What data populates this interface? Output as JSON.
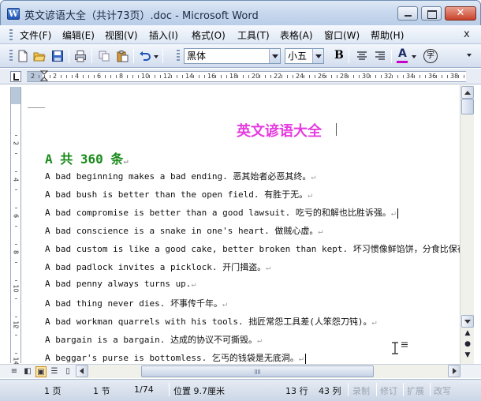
{
  "window": {
    "title": "英文谚语大全（共计73页）.doc - Microsoft Word",
    "app_icon_letter": "W",
    "close_glyph": "✕"
  },
  "menu": {
    "items": [
      "文件(F)",
      "编辑(E)",
      "视图(V)",
      "插入(I)",
      "格式(O)",
      "工具(T)",
      "表格(A)",
      "窗口(W)",
      "帮助(H)"
    ],
    "close_x": "x"
  },
  "toolbar": {
    "font_name": "黑体",
    "font_size": "小五",
    "bold_label": "B",
    "font_color_label": "A",
    "phonetic_label": "字",
    "font_color": "#c800c8"
  },
  "ruler": {
    "h_numbers": [
      "2",
      "2",
      "4",
      "6",
      "8",
      "10",
      "12",
      "14",
      "16",
      "18",
      "20",
      "22",
      "24",
      "26",
      "28",
      "30",
      "32",
      "34",
      "36",
      "38"
    ],
    "v_numbers": [
      "2",
      "4",
      "6",
      "8",
      "10",
      "12",
      "14"
    ]
  },
  "document": {
    "title": "英文谚语大全",
    "subtitle": "A 共 360 条",
    "lines": [
      "A bad beginning makes a bad ending. 恶其始者必恶其终。",
      "A bad bush is better than the open field. 有胜于无。",
      "A bad compromise is better than a good lawsuit. 吃亏的和解也比胜诉强。",
      "A bad conscience is a snake in one's heart. 做贼心虚。",
      "A bad custom is like a good cake, better broken than kept. 坏习惯像鲜馅饼，分食比保存好。",
      "A bad padlock invites a picklock. 开门揖盗。",
      "A bad penny always turns up.",
      "A bad thing never dies. 坏事传千年。",
      "A bad workman quarrels with his tools. 拙匠常怨工具差(人笨怨刀钝)。",
      "A bargain is a bargain. 达成的协议不可撕毁。",
      "A beggar's purse is bottomless. 乞丐的钱袋是无底洞。"
    ],
    "paragraph_mark": "↵",
    "title_color": "#e53bdf",
    "subtitle_color": "#1a8a1a"
  },
  "status": {
    "page": "1 页",
    "section": "1 节",
    "page_of": "1/74",
    "position": "位置 9.7厘米",
    "line": "13 行",
    "column": "43 列",
    "rec": "录制",
    "trk": "修订",
    "ext": "扩展",
    "ovr": "改写"
  }
}
